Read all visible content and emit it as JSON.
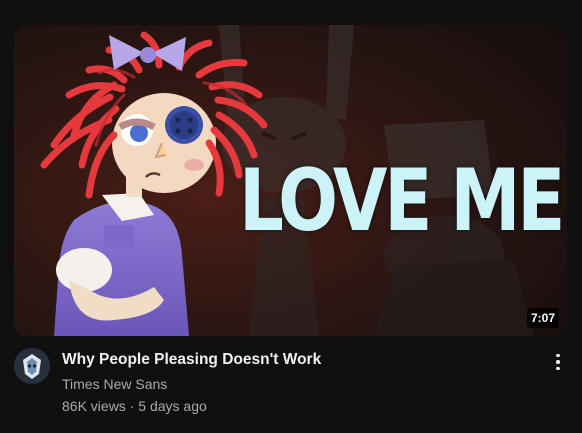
{
  "video": {
    "thumbnail_text": "LOVE ME.",
    "duration": "7:07",
    "title": "Why People Pleasing Doesn't Work",
    "channel": "Times New Sans",
    "views": "86K views",
    "separator": "·",
    "age": "5 days ago"
  },
  "icons": {
    "more_actions": "vertical-ellipsis-icon",
    "avatar": "channel-avatar-icon"
  },
  "colors": {
    "background": "#0f0f0f",
    "title": "#f1f1f1",
    "secondary_text": "#aaaaaa",
    "thumbnail_text": "#ccf3f8"
  }
}
